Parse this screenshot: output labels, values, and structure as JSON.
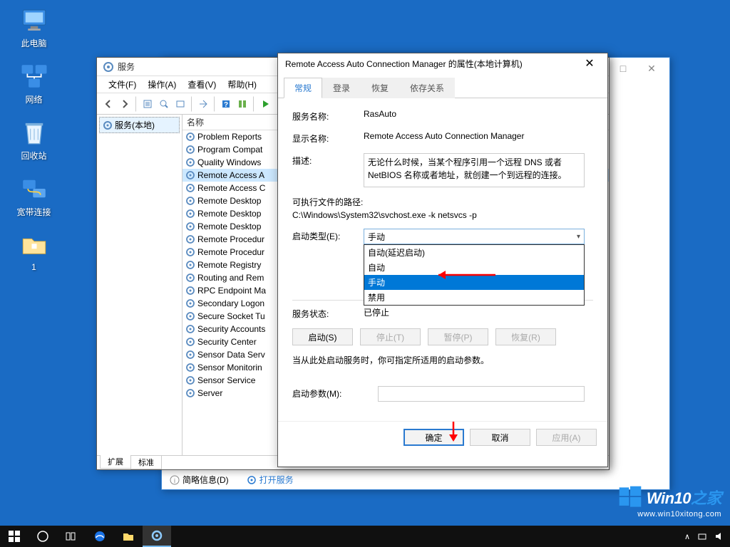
{
  "desktop": {
    "icons": [
      "此电脑",
      "网络",
      "回收站",
      "宽带连接",
      "1"
    ]
  },
  "bgwin": {
    "buttons": [
      "—",
      "□",
      "✕"
    ]
  },
  "services": {
    "title": "服务",
    "menu": [
      "文件(F)",
      "操作(A)",
      "查看(V)",
      "帮助(H)"
    ],
    "tree_label": "服务(本地)",
    "col_name": "名称",
    "items": [
      "Problem Reports",
      "Program Compat",
      "Quality Windows",
      "Remote Access A",
      "Remote Access C",
      "Remote Desktop",
      "Remote Desktop",
      "Remote Desktop",
      "Remote Procedur",
      "Remote Procedur",
      "Remote Registry",
      "Routing and Rem",
      "RPC Endpoint Ma",
      "Secondary Logon",
      "Secure Socket Tu",
      "Security Accounts",
      "Security Center",
      "Sensor Data Serv",
      "Sensor Monitorin",
      "Sensor Service",
      "Server"
    ],
    "selected_index": 3,
    "foot_tabs": [
      "扩展",
      "标准"
    ]
  },
  "props": {
    "title": "Remote Access Auto Connection Manager 的属性(本地计算机)",
    "tabs": [
      "常规",
      "登录",
      "恢复",
      "依存关系"
    ],
    "labels": {
      "service_name": "服务名称:",
      "display_name": "显示名称:",
      "description": "描述:",
      "exe_path": "可执行文件的路径:",
      "startup_type": "启动类型(E):",
      "service_status": "服务状态:",
      "start_params": "启动参数(M):",
      "help1": "当从此处启动服务时，你可指定所适用的启动参数。"
    },
    "values": {
      "service_name": "RasAuto",
      "display_name": "Remote Access Auto Connection Manager",
      "description": "无论什么时候，当某个程序引用一个远程 DNS 或者 NetBIOS 名称或者地址，就创建一个到远程的连接。",
      "exe_path": "C:\\Windows\\System32\\svchost.exe -k netsvcs -p",
      "startup_selected": "手动",
      "service_status": "已停止"
    },
    "startup_options": [
      "自动(延迟启动)",
      "自动",
      "手动",
      "禁用"
    ],
    "startup_sel_index": 2,
    "action_buttons": [
      "启动(S)",
      "停止(T)",
      "暂停(P)",
      "恢复(R)"
    ],
    "dialog_buttons": [
      "确定",
      "取消",
      "应用(A)"
    ]
  },
  "sub_info": {
    "label": "简略信息(D)",
    "link": "打开服务"
  },
  "watermark": {
    "brand_a": "Win10",
    "brand_b": "之家",
    "url": "www.win10xitong.com"
  },
  "tray": {
    "chevron": "∧"
  }
}
